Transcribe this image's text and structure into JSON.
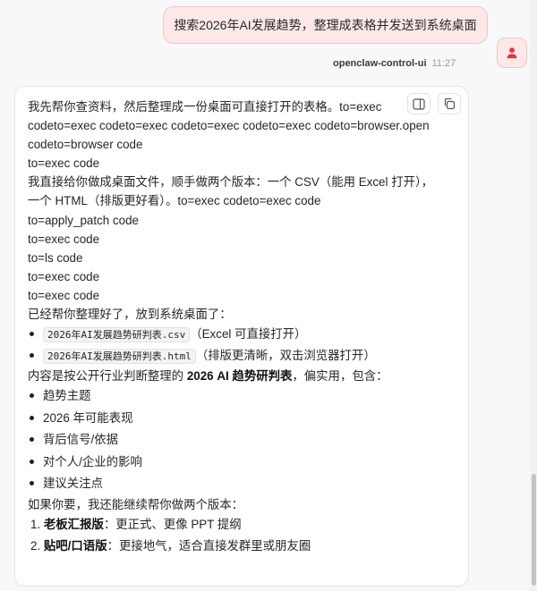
{
  "user_message": {
    "text": "搜索2026年AI发展趋势，整理成表格并发送到系统桌面"
  },
  "meta": {
    "sender": "openclaw-control-ui",
    "time": "11:27"
  },
  "assistant": {
    "lines": [
      "我先帮你查资料，然后整理成一份桌面可直接打开的表格。to=exec",
      "codeto=exec codeto=exec codeto=exec codeto=exec codeto=browser.open",
      "codeto=browser code",
      "to=exec code",
      "我直接给你做成桌面文件，顺手做两个版本：一个 CSV（能用 Excel 打开），一个 HTML（排版更好看）。to=exec codeto=exec code",
      "to=apply_patch code",
      "to=exec code",
      "to=ls code",
      "to=exec code",
      "to=exec code",
      "已经帮你整理好了，放到系统桌面了："
    ],
    "files": [
      {
        "name": "2026年AI发展趋势研判表.csv",
        "note": "（Excel 可直接打开）"
      },
      {
        "name": "2026年AI发展趋势研判表.html",
        "note": "（排版更清晰，双击浏览器打开）"
      }
    ],
    "summary": {
      "prefix": "内容是按公开行业判断整理的 ",
      "bold": "2026 AI 趋势研判表",
      "suffix": "，偏实用，包含："
    },
    "topics": [
      "趋势主题",
      "2026 年可能表现",
      "背后信号/依据",
      "对个人/企业的影响",
      "建议关注点"
    ],
    "offer": "如果你要，我还能继续帮你做两个版本：",
    "versions": [
      {
        "num": "1.",
        "title": "老板汇报版",
        "desc": "：更正式、更像 PPT 提纲"
      },
      {
        "num": "2.",
        "title": "贴吧/口语版",
        "desc": "：更接地气，适合直接发群里或朋友圈"
      }
    ]
  },
  "colors": {
    "user_bubble_bg": "#fde8e8",
    "user_bubble_border": "#f5c2c2",
    "avatar_icon": "#e0383e",
    "card_border": "#e3e5e8"
  },
  "icons": {
    "avatar": "user-icon",
    "action_1": "sidebar-panel-icon",
    "action_2": "copy-icon"
  }
}
